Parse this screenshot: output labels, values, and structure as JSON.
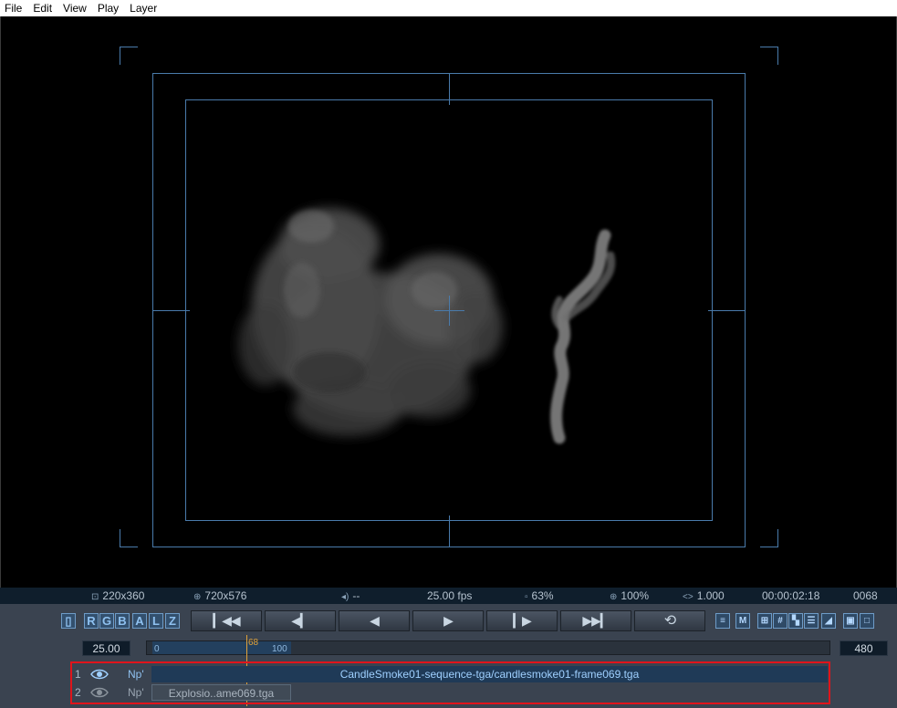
{
  "menu": [
    "File",
    "Edit",
    "View",
    "Play",
    "Layer"
  ],
  "status": {
    "source_res": "220x360",
    "output_res": "720x576",
    "audio": "--",
    "fps": "25.00 fps",
    "memory": "63%",
    "zoom": "100%",
    "aspect": "1.000",
    "timecode": "00:00:02:18",
    "frame": "0068"
  },
  "channels": [
    "R",
    "G",
    "B",
    "A",
    "L",
    "Z"
  ],
  "transport": [
    {
      "name": "first-frame",
      "glyph": "▎◀◀"
    },
    {
      "name": "step-back",
      "glyph": "◀▎"
    },
    {
      "name": "play-reverse",
      "glyph": "◀"
    },
    {
      "name": "play",
      "glyph": "▶"
    },
    {
      "name": "step-forward",
      "glyph": "▎▶"
    },
    {
      "name": "last-frame",
      "glyph": "▶▶▎"
    },
    {
      "name": "loop",
      "glyph": "⟲"
    }
  ],
  "tools": [
    {
      "name": "list-icon",
      "glyph": "≡"
    },
    {
      "name": "m-icon",
      "glyph": "M"
    },
    {
      "name": "safe-frame-icon",
      "glyph": "⊞"
    },
    {
      "name": "grid-icon",
      "glyph": "#"
    },
    {
      "name": "checker-icon",
      "glyph": "▚"
    },
    {
      "name": "info-icon",
      "glyph": "☰"
    },
    {
      "name": "lut-icon",
      "glyph": "◢"
    },
    {
      "name": "compare-icon",
      "glyph": "▣"
    },
    {
      "name": "fullscreen-icon",
      "glyph": "□"
    }
  ],
  "timeline": {
    "fps_field": "25.00",
    "end_field": "480",
    "tick_start": "0",
    "tick_end": "100",
    "playhead_label": "68",
    "current_frame": 68,
    "range_start": 0,
    "range_end": 100
  },
  "layers": [
    {
      "num": "1",
      "mode": "Np'",
      "name": "CandleSmoke01-sequence-tga/candlesmoke01-frame069.tga",
      "visible": true
    },
    {
      "num": "2",
      "mode": "Np'",
      "name": "Explosio..ame069.tga",
      "visible": false
    }
  ],
  "colors": {
    "guide": "#4a7bab",
    "accent": "#6e9cc8",
    "playhead": "#e0a23a",
    "highlight": "#e0141b"
  }
}
